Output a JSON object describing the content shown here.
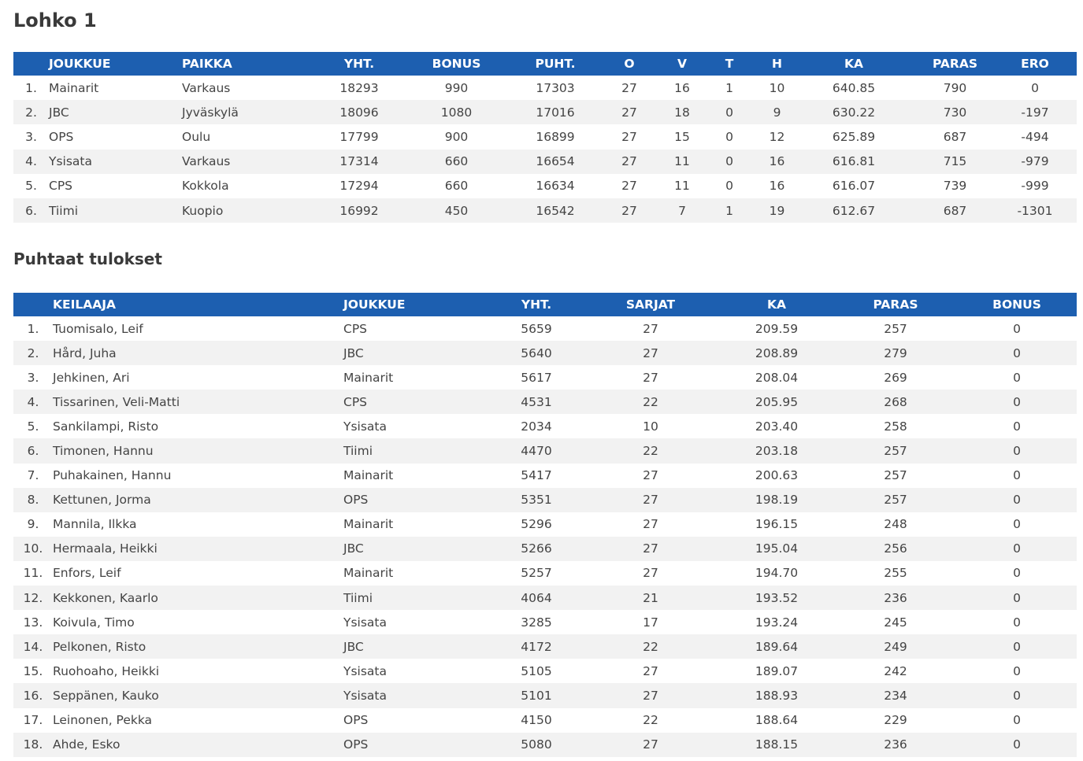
{
  "standings": {
    "title": "Lohko 1",
    "headers": {
      "joukkue": "JOUKKUE",
      "paikka": "PAIKKA",
      "yht": "YHT.",
      "bonus": "BONUS",
      "puht": "PUHT.",
      "o": "O",
      "v": "V",
      "t": "T",
      "h": "H",
      "ka": "KA",
      "paras": "PARAS",
      "ero": "ERO"
    },
    "rows": [
      {
        "rank": "1.",
        "team": "Mainarit",
        "place": "Varkaus",
        "yht": "18293",
        "bonus": "990",
        "puht": "17303",
        "o": "27",
        "v": "16",
        "t": "1",
        "h": "10",
        "ka": "640.85",
        "paras": "790",
        "ero": "0"
      },
      {
        "rank": "2.",
        "team": "JBC",
        "place": "Jyväskylä",
        "yht": "18096",
        "bonus": "1080",
        "puht": "17016",
        "o": "27",
        "v": "18",
        "t": "0",
        "h": "9",
        "ka": "630.22",
        "paras": "730",
        "ero": "-197"
      },
      {
        "rank": "3.",
        "team": "OPS",
        "place": "Oulu",
        "yht": "17799",
        "bonus": "900",
        "puht": "16899",
        "o": "27",
        "v": "15",
        "t": "0",
        "h": "12",
        "ka": "625.89",
        "paras": "687",
        "ero": "-494"
      },
      {
        "rank": "4.",
        "team": "Ysisata",
        "place": "Varkaus",
        "yht": "17314",
        "bonus": "660",
        "puht": "16654",
        "o": "27",
        "v": "11",
        "t": "0",
        "h": "16",
        "ka": "616.81",
        "paras": "715",
        "ero": "-979"
      },
      {
        "rank": "5.",
        "team": "CPS",
        "place": "Kokkola",
        "yht": "17294",
        "bonus": "660",
        "puht": "16634",
        "o": "27",
        "v": "11",
        "t": "0",
        "h": "16",
        "ka": "616.07",
        "paras": "739",
        "ero": "-999"
      },
      {
        "rank": "6.",
        "team": "Tiimi",
        "place": "Kuopio",
        "yht": "16992",
        "bonus": "450",
        "puht": "16542",
        "o": "27",
        "v": "7",
        "t": "1",
        "h": "19",
        "ka": "612.67",
        "paras": "687",
        "ero": "-1301"
      }
    ]
  },
  "players": {
    "title": "Puhtaat tulokset",
    "headers": {
      "keilaaja": "KEILAAJA",
      "joukkue": "JOUKKUE",
      "yht": "YHT.",
      "sarjat": "SARJAT",
      "ka": "KA",
      "paras": "PARAS",
      "bonus": "BONUS"
    },
    "rows": [
      {
        "rank": "1.",
        "name": "Tuomisalo, Leif",
        "team": "CPS",
        "yht": "5659",
        "sarjat": "27",
        "ka": "209.59",
        "paras": "257",
        "bonus": "0"
      },
      {
        "rank": "2.",
        "name": "Hård, Juha",
        "team": "JBC",
        "yht": "5640",
        "sarjat": "27",
        "ka": "208.89",
        "paras": "279",
        "bonus": "0"
      },
      {
        "rank": "3.",
        "name": "Jehkinen, Ari",
        "team": "Mainarit",
        "yht": "5617",
        "sarjat": "27",
        "ka": "208.04",
        "paras": "269",
        "bonus": "0"
      },
      {
        "rank": "4.",
        "name": "Tissarinen, Veli-Matti",
        "team": "CPS",
        "yht": "4531",
        "sarjat": "22",
        "ka": "205.95",
        "paras": "268",
        "bonus": "0"
      },
      {
        "rank": "5.",
        "name": "Sankilampi, Risto",
        "team": "Ysisata",
        "yht": "2034",
        "sarjat": "10",
        "ka": "203.40",
        "paras": "258",
        "bonus": "0"
      },
      {
        "rank": "6.",
        "name": "Timonen, Hannu",
        "team": "Tiimi",
        "yht": "4470",
        "sarjat": "22",
        "ka": "203.18",
        "paras": "257",
        "bonus": "0"
      },
      {
        "rank": "7.",
        "name": "Puhakainen, Hannu",
        "team": "Mainarit",
        "yht": "5417",
        "sarjat": "27",
        "ka": "200.63",
        "paras": "257",
        "bonus": "0"
      },
      {
        "rank": "8.",
        "name": "Kettunen, Jorma",
        "team": "OPS",
        "yht": "5351",
        "sarjat": "27",
        "ka": "198.19",
        "paras": "257",
        "bonus": "0"
      },
      {
        "rank": "9.",
        "name": "Mannila, Ilkka",
        "team": "Mainarit",
        "yht": "5296",
        "sarjat": "27",
        "ka": "196.15",
        "paras": "248",
        "bonus": "0"
      },
      {
        "rank": "10.",
        "name": "Hermaala, Heikki",
        "team": "JBC",
        "yht": "5266",
        "sarjat": "27",
        "ka": "195.04",
        "paras": "256",
        "bonus": "0"
      },
      {
        "rank": "11.",
        "name": "Enfors, Leif",
        "team": "Mainarit",
        "yht": "5257",
        "sarjat": "27",
        "ka": "194.70",
        "paras": "255",
        "bonus": "0"
      },
      {
        "rank": "12.",
        "name": "Kekkonen, Kaarlo",
        "team": "Tiimi",
        "yht": "4064",
        "sarjat": "21",
        "ka": "193.52",
        "paras": "236",
        "bonus": "0"
      },
      {
        "rank": "13.",
        "name": "Koivula, Timo",
        "team": "Ysisata",
        "yht": "3285",
        "sarjat": "17",
        "ka": "193.24",
        "paras": "245",
        "bonus": "0"
      },
      {
        "rank": "14.",
        "name": "Pelkonen, Risto",
        "team": "JBC",
        "yht": "4172",
        "sarjat": "22",
        "ka": "189.64",
        "paras": "249",
        "bonus": "0"
      },
      {
        "rank": "15.",
        "name": "Ruohoaho, Heikki",
        "team": "Ysisata",
        "yht": "5105",
        "sarjat": "27",
        "ka": "189.07",
        "paras": "242",
        "bonus": "0"
      },
      {
        "rank": "16.",
        "name": "Seppänen, Kauko",
        "team": "Ysisata",
        "yht": "5101",
        "sarjat": "27",
        "ka": "188.93",
        "paras": "234",
        "bonus": "0"
      },
      {
        "rank": "17.",
        "name": "Leinonen, Pekka",
        "team": "OPS",
        "yht": "4150",
        "sarjat": "22",
        "ka": "188.64",
        "paras": "229",
        "bonus": "0"
      },
      {
        "rank": "18.",
        "name": "Ahde, Esko",
        "team": "OPS",
        "yht": "5080",
        "sarjat": "27",
        "ka": "188.15",
        "paras": "236",
        "bonus": "0"
      }
    ]
  },
  "colors": {
    "header_bg": "#1d5fb0",
    "stripe_bg": "#f2f2f2"
  }
}
